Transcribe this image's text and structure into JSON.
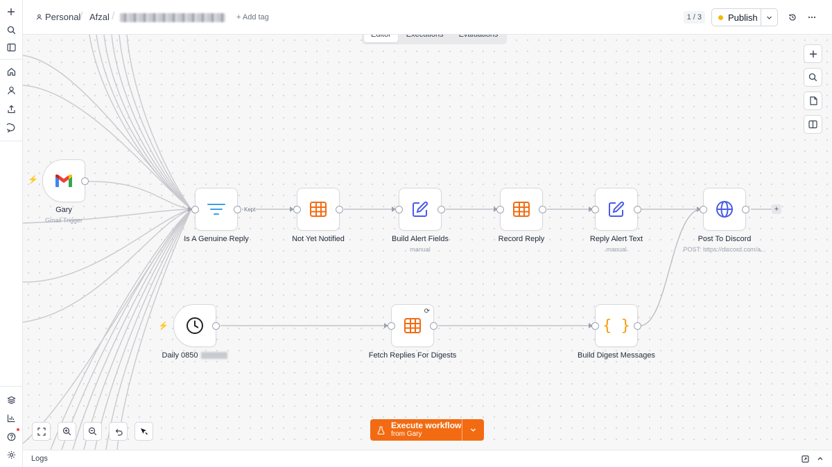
{
  "breadcrumb": {
    "project": "Personal",
    "folder": "Afzal",
    "add_tag": "+ Add tag"
  },
  "header": {
    "pager": "1 / 3",
    "publish_label": "Publish",
    "publish_status_color": "#f5b800"
  },
  "tabs": [
    {
      "label": "Editor",
      "active": true
    },
    {
      "label": "Executions",
      "active": false
    },
    {
      "label": "Evaluations",
      "active": false
    }
  ],
  "nodes": {
    "gmail": {
      "label": "Gary",
      "sub": "Gmail Trigger",
      "icon": "gmail-icon"
    },
    "filter": {
      "label": "Is A Genuine Reply",
      "icon": "filter-icon",
      "output_label": "Kept"
    },
    "not_notified": {
      "label": "Not Yet Notified",
      "icon": "table-icon"
    },
    "alert_fields": {
      "label": "Build Alert Fields",
      "sub": "manual",
      "icon": "edit-icon"
    },
    "record_reply": {
      "label": "Record Reply",
      "icon": "table-icon"
    },
    "alert_text": {
      "label": "Reply Alert Text",
      "sub": "manual",
      "icon": "edit-icon"
    },
    "discord": {
      "label": "Post To Discord",
      "sub": "POST: https://discord.com/a...",
      "icon": "globe-icon"
    },
    "schedule": {
      "label": "Daily 0850",
      "icon": "clock-icon"
    },
    "fetch": {
      "label": "Fetch Replies For Digests",
      "icon": "table-icon"
    },
    "digest": {
      "label": "Build Digest Messages",
      "icon": "code-braces-icon"
    }
  },
  "execute": {
    "title": "Execute workflow",
    "subtitle": "from Gary",
    "color": "#f26b12"
  },
  "logs": {
    "label": "Logs"
  },
  "colors": {
    "accent_orange": "#f97316",
    "icon_blue": "#4a5ae8",
    "filter_blue": "#3aa0e8"
  }
}
